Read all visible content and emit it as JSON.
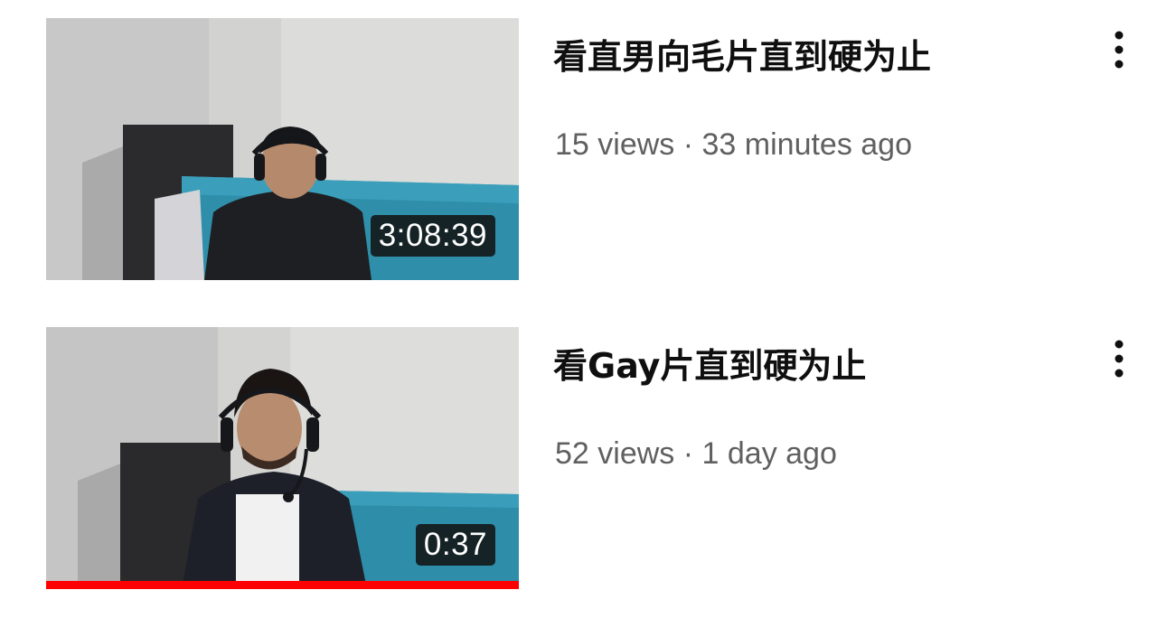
{
  "videos": [
    {
      "title": "看直男向毛片直到硬为止",
      "views": "15 views",
      "separator": "·",
      "age": "33 minutes ago",
      "duration": "3:08:39",
      "watch_progress": 0,
      "more_icon": "more-vert-icon"
    },
    {
      "title": "看Gay片直到硬为止",
      "views": "52 views",
      "separator": "·",
      "age": "1 day ago",
      "duration": "0:37",
      "watch_progress": 1.0,
      "more_icon": "more-vert-icon"
    }
  ],
  "colors": {
    "title": "#0f0f0f",
    "meta": "#606060",
    "progress": "#ff0000",
    "duration_bg": "#121212"
  }
}
